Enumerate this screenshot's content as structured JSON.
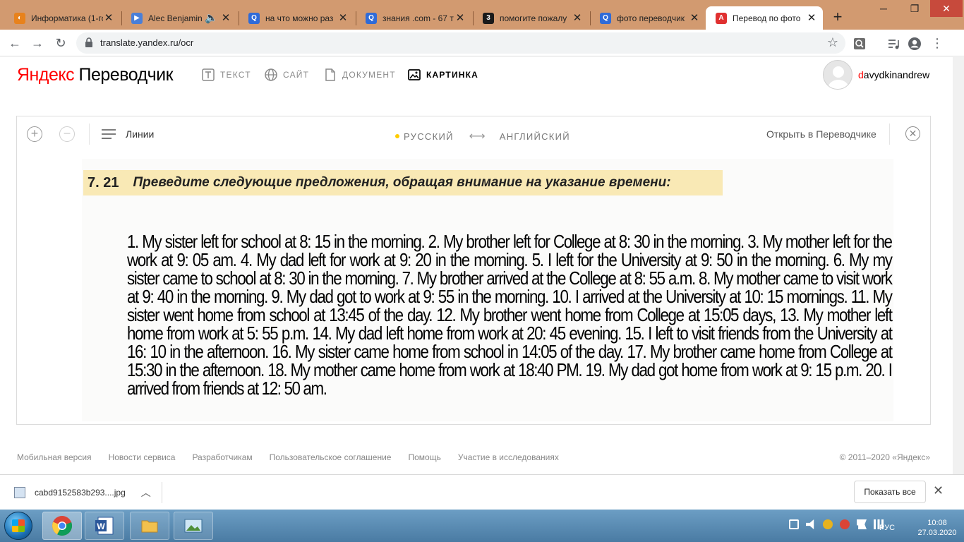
{
  "browser": {
    "tabs": [
      {
        "title": "Информатика (1-го",
        "favicon": "yandex-school-icon",
        "color": "#e8821c"
      },
      {
        "title": "Alec Benjamin",
        "favicon": "play-icon",
        "color": "#4a7fd8"
      },
      {
        "title": "на что можно раз",
        "favicon": "search-q-icon",
        "color": "#2f6bd8"
      },
      {
        "title": "знания .com - 67 т",
        "favicon": "search-q-icon",
        "color": "#2f6bd8"
      },
      {
        "title": "помогите пожалу",
        "favicon": "znanija-icon",
        "color": "#1a1a1a"
      },
      {
        "title": "фото переводчик",
        "favicon": "search-q-icon",
        "color": "#2f6bd8"
      },
      {
        "title": "Перевод по фото",
        "favicon": "yandex-translate-icon",
        "color": "#e03030"
      }
    ],
    "url": "translate.yandex.ru/ocr"
  },
  "header": {
    "logo_brand": "Яндекс",
    "logo_service": "Переводчик",
    "nav": [
      {
        "label": "ТЕКСТ",
        "icon": "text-t-icon"
      },
      {
        "label": "САЙТ",
        "icon": "globe-icon"
      },
      {
        "label": "ДОКУМЕНТ",
        "icon": "document-icon"
      },
      {
        "label": "КАРТИНКА",
        "icon": "image-icon"
      }
    ],
    "user_first": "d",
    "user_rest": "avydkinandrew"
  },
  "panel": {
    "lines_label": "Линии",
    "source_lang": "РУССКИЙ",
    "target_lang": "АНГЛИЙСКИЙ",
    "open_label": "Открыть в Переводчике",
    "heading_number": "7. 21",
    "heading_text": "Преведите следующие предложения, обращая внимание на указание времени:",
    "translated_text": "1. My sister left for school at 8: 15 in the morning. 2. My brother left for College at 8: 30 in the morning. 3. My mother left for the work at 9: 05 am. 4. My dad left for work at 9: 20 in the morning. 5. I left for the University at 9: 50 in the morning. 6. My my sister came to school at 8: 30 in the morning. 7. My brother arrived at the College at 8: 55 a.m. 8. My mother came to visit work at 9: 40 in the morning. 9. My dad got to work at 9: 55 in the morning. 10. I arrived at the University at 10: 15 mornings. 11. My sister went home from school at 13:45 of the day. 12. My brother went home from College at 15:05 days, 13. My mother left home from work at 5: 55 p.m. 14. My dad left home from work at 20: 45 evening. 15. I left to visit friends from the University at 16: 10 in the afternoon. 16. My sister came home from school in 14:05 of the day. 17. My brother came home from College at 15:30 in the afternoon. 18. My mother came home from work at 18:40 PM. 19. My dad got home from work at 9: 15 p.m. 20. I arrived from friends at 12: 50 am."
  },
  "footer": {
    "links": [
      "Мобильная версия",
      "Новости сервиса",
      "Разработчикам",
      "Пользовательское соглашение",
      "Помощь",
      "Участие в исследованиях"
    ],
    "copyright": "© 2011–2020 «Яндекс»"
  },
  "downloads": {
    "file_name": "cabd9152583b293....jpg",
    "show_all": "Показать все"
  },
  "taskbar": {
    "lang": "РУС",
    "time": "10:08",
    "date": "27.03.2020"
  }
}
